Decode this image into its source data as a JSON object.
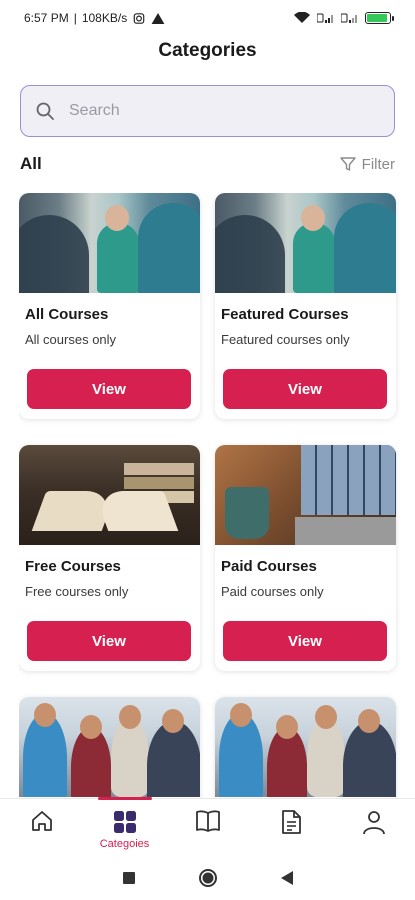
{
  "status_bar": {
    "time": "6:57 PM",
    "network_speed": "108KB/s",
    "battery_color": "#34c759",
    "battery_level": 0.9
  },
  "header": {
    "title": "Categories"
  },
  "search": {
    "placeholder": "Search"
  },
  "filter_row": {
    "all_label": "All",
    "filter_label": "Filter"
  },
  "categories": [
    {
      "title": "All Courses",
      "subtitle": "All courses only",
      "button": "View",
      "image": "medical-team-photo"
    },
    {
      "title": "Featured Courses",
      "subtitle": "Featured courses only",
      "button": "View",
      "image": "medical-team-photo"
    },
    {
      "title": "Free Courses",
      "subtitle": "Free courses only",
      "button": "View",
      "image": "open-book-photo"
    },
    {
      "title": "Paid Courses",
      "subtitle": "Paid courses only",
      "button": "View",
      "image": "laptop-video-call-photo"
    },
    {
      "title": "",
      "subtitle": "",
      "button": "",
      "image": "group-laptop-photo"
    },
    {
      "title": "",
      "subtitle": "",
      "button": "",
      "image": "group-laptop-photo"
    }
  ],
  "bottom_nav": {
    "items": [
      {
        "icon": "home-icon",
        "label": ""
      },
      {
        "icon": "grid-icon",
        "label": "Categoies",
        "active": true
      },
      {
        "icon": "book-icon",
        "label": ""
      },
      {
        "icon": "document-icon",
        "label": ""
      },
      {
        "icon": "profile-icon",
        "label": ""
      }
    ]
  },
  "colors": {
    "accent": "#d6204f",
    "nav_active_icon": "#3a2a6e",
    "search_border": "#9b8fd1",
    "search_bg": "#f1eff6"
  }
}
